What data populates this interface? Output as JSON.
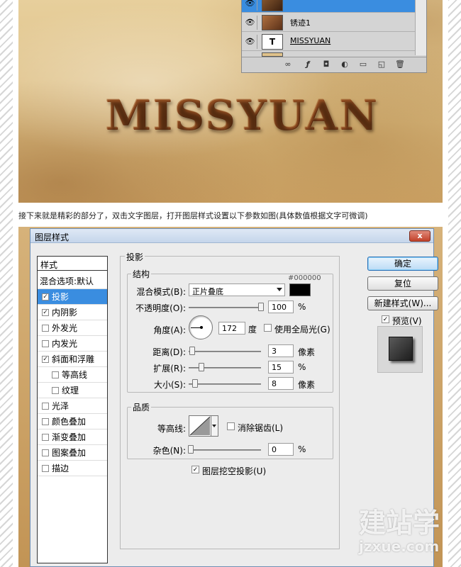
{
  "artwork": {
    "title": "MISSYUAN",
    "layers": [
      {
        "name": "锈迹1"
      },
      {
        "name": "MISSYUAN",
        "thumb": "T"
      }
    ]
  },
  "caption": "接下来就是精彩的部分了，双击文字图层，打开图层样式设置以下参数如图(具体数值根据文字可微调)",
  "dialog": {
    "title": "图层样式",
    "close": "x",
    "styles_header": "样式",
    "blend_default": "混合选项:默认",
    "style_items": [
      {
        "label": "投影",
        "checked": true,
        "selected": true
      },
      {
        "label": "内阴影",
        "checked": true
      },
      {
        "label": "外发光",
        "checked": false
      },
      {
        "label": "内发光",
        "checked": false
      },
      {
        "label": "斜面和浮雕",
        "checked": true
      },
      {
        "label": "等高线",
        "checked": false,
        "sub": true
      },
      {
        "label": "纹理",
        "checked": false,
        "sub": true
      },
      {
        "label": "光泽",
        "checked": false
      },
      {
        "label": "颜色叠加",
        "checked": false
      },
      {
        "label": "渐变叠加",
        "checked": false
      },
      {
        "label": "图案叠加",
        "checked": false
      },
      {
        "label": "描边",
        "checked": false
      }
    ],
    "section_title": "投影",
    "structure": {
      "title": "结构",
      "color_hex": "#000000",
      "blend_mode_label": "混合模式(B):",
      "blend_mode_value": "正片叠底",
      "opacity_label": "不透明度(O):",
      "opacity_value": "100",
      "opacity_unit": "%",
      "angle_label": "角度(A):",
      "angle_value": "172",
      "angle_unit": "度",
      "global_light_label": "使用全局光(G)",
      "distance_label": "距离(D):",
      "distance_value": "3",
      "distance_unit": "像素",
      "spread_label": "扩展(R):",
      "spread_value": "15",
      "spread_unit": "%",
      "size_label": "大小(S):",
      "size_value": "8",
      "size_unit": "像素"
    },
    "quality": {
      "title": "品质",
      "contour_label": "等高线:",
      "antialias_label": "消除锯齿(L)",
      "noise_label": "杂色(N):",
      "noise_value": "0",
      "noise_unit": "%"
    },
    "knockout_label": "图层挖空投影(U)",
    "buttons": {
      "ok": "确定",
      "reset": "复位",
      "new_style": "新建样式(W)...",
      "preview": "预览(V)"
    }
  },
  "watermark": {
    "cn": "建站学",
    "en": "jzxue.com"
  }
}
